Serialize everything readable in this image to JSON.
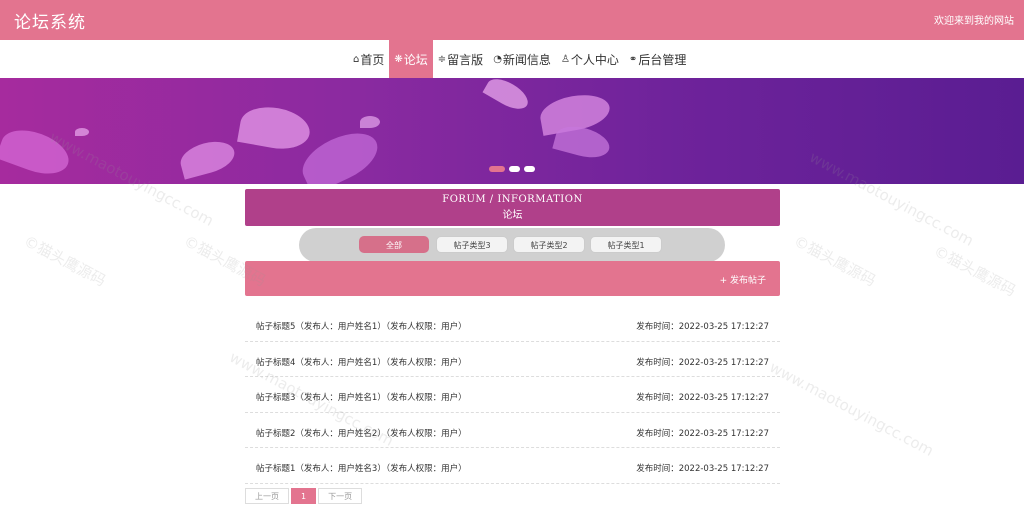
{
  "header": {
    "site_title": "论坛系统",
    "welcome": "欢迎来到我的网站"
  },
  "nav": {
    "items": [
      {
        "icon": "⌂",
        "label": "首页"
      },
      {
        "icon": "❋",
        "label": "论坛"
      },
      {
        "icon": "≑",
        "label": "留言版"
      },
      {
        "icon": "◔",
        "label": "新闻信息"
      },
      {
        "icon": "♙",
        "label": "个人中心"
      },
      {
        "icon": "⚭",
        "label": "后台管理"
      }
    ]
  },
  "forum": {
    "title_en": "FORUM / INFORMATION",
    "title_cn": "论坛"
  },
  "filters": [
    "全部",
    "帖子类型3",
    "帖子类型2",
    "帖子类型1"
  ],
  "post_button": {
    "icon": "+",
    "label": "发布帖子"
  },
  "posts": [
    {
      "title": "帖子标题5（发布人：用户姓名1）（发布人权限：用户）",
      "time": "发布时间：2022-03-25 17:12:27"
    },
    {
      "title": "帖子标题4（发布人：用户姓名1）（发布人权限：用户）",
      "time": "发布时间：2022-03-25 17:12:27"
    },
    {
      "title": "帖子标题3（发布人：用户姓名1）（发布人权限：用户）",
      "time": "发布时间：2022-03-25 17:12:27"
    },
    {
      "title": "帖子标题2（发布人：用户姓名2）（发布人权限：用户）",
      "time": "发布时间：2022-03-25 17:12:27"
    },
    {
      "title": "帖子标题1（发布人：用户姓名3）（发布人权限：用户）",
      "time": "发布时间：2022-03-25 17:12:27"
    }
  ],
  "pager": {
    "prev": "上一页",
    "current": "1",
    "next": "下一页"
  },
  "watermark": {
    "text_cn": "©猫头鹰源码",
    "text_url": "www.maotouyingcc.com"
  },
  "colors": {
    "accent": "#e3748f",
    "header_band": "#b0408a"
  }
}
